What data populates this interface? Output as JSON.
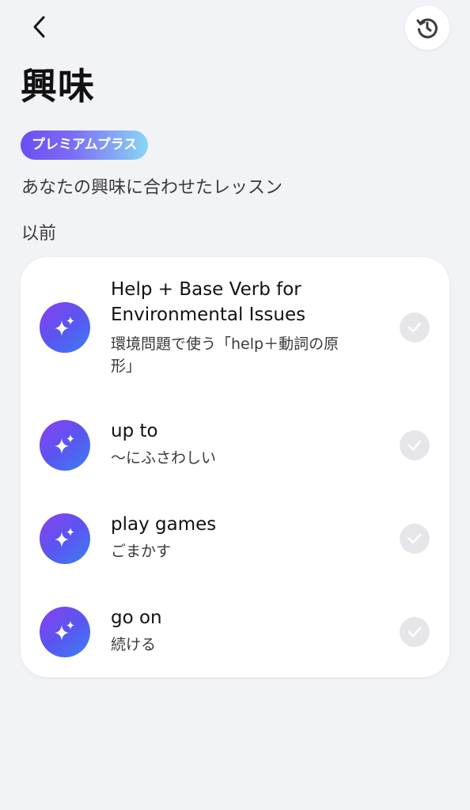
{
  "header": {
    "back_icon": "chevron-left-icon",
    "history_icon": "history-icon"
  },
  "page": {
    "title": "興味",
    "badge": "プレミアムプラス",
    "subtitle": "あなたの興味に合わせたレッスン",
    "section_label": "以前"
  },
  "lessons": [
    {
      "title": "Help + Base Verb for Environmental Issues",
      "subtitle": "環境問題で使う「help＋動詞の原形」",
      "icon": "sparkle-icon",
      "completed": false
    },
    {
      "title": "up to",
      "subtitle": "〜にふさわしい",
      "icon": "sparkle-icon",
      "completed": false
    },
    {
      "title": "play games",
      "subtitle": "ごまかす",
      "icon": "sparkle-icon",
      "completed": false
    },
    {
      "title": "go on",
      "subtitle": "続ける",
      "icon": "sparkle-icon",
      "completed": false
    }
  ],
  "colors": {
    "background": "#f2f3f7",
    "card": "#ffffff",
    "badge_gradient_start": "#6b4ef2",
    "badge_gradient_end": "#8ad6f4",
    "icon_gradient_start": "#8b3ff0",
    "icon_gradient_end": "#3c7ef5",
    "check_bg": "#e6e6ea"
  }
}
